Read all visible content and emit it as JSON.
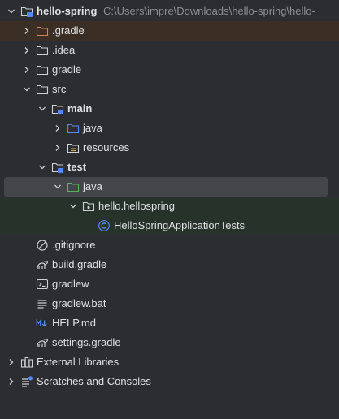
{
  "project": {
    "name": "hello-spring",
    "path": "C:\\Users\\impre\\Downloads\\hello-spring\\hello-"
  },
  "tree": {
    "gradle_hidden": ".gradle",
    "idea": ".idea",
    "gradle": "gradle",
    "src": "src",
    "main": "main",
    "main_java": "java",
    "resources": "resources",
    "test": "test",
    "test_java": "java",
    "package": "hello.hellospring",
    "test_class": "HelloSpringApplicationTests",
    "gitignore": ".gitignore",
    "build_gradle": "build.gradle",
    "gradlew": "gradlew",
    "gradlew_bat": "gradlew.bat",
    "help_md": "HELP.md",
    "settings_gradle": "settings.gradle",
    "external_libraries": "External Libraries",
    "scratches": "Scratches and Consoles"
  },
  "colors": {
    "background": "#2b2d30",
    "selection": "#43454a",
    "excluded_row": "#3b2e25",
    "test_rows": "#27322a",
    "folder_orange": "#d2875b",
    "folder_blue": "#548af7",
    "folder_green": "#5fad65"
  },
  "icons": {
    "chevron_right": "chevron-right-icon",
    "chevron_down": "chevron-down-icon",
    "folder": "folder-icon",
    "module": "module-folder-icon",
    "package": "package-icon",
    "class": "class-icon",
    "gitignore": "gitignore-icon",
    "gradle": "gradle-icon",
    "terminal": "terminal-script-icon",
    "text": "text-file-icon",
    "markdown": "markdown-icon",
    "libraries": "libraries-icon",
    "scratches": "scratches-icon"
  }
}
